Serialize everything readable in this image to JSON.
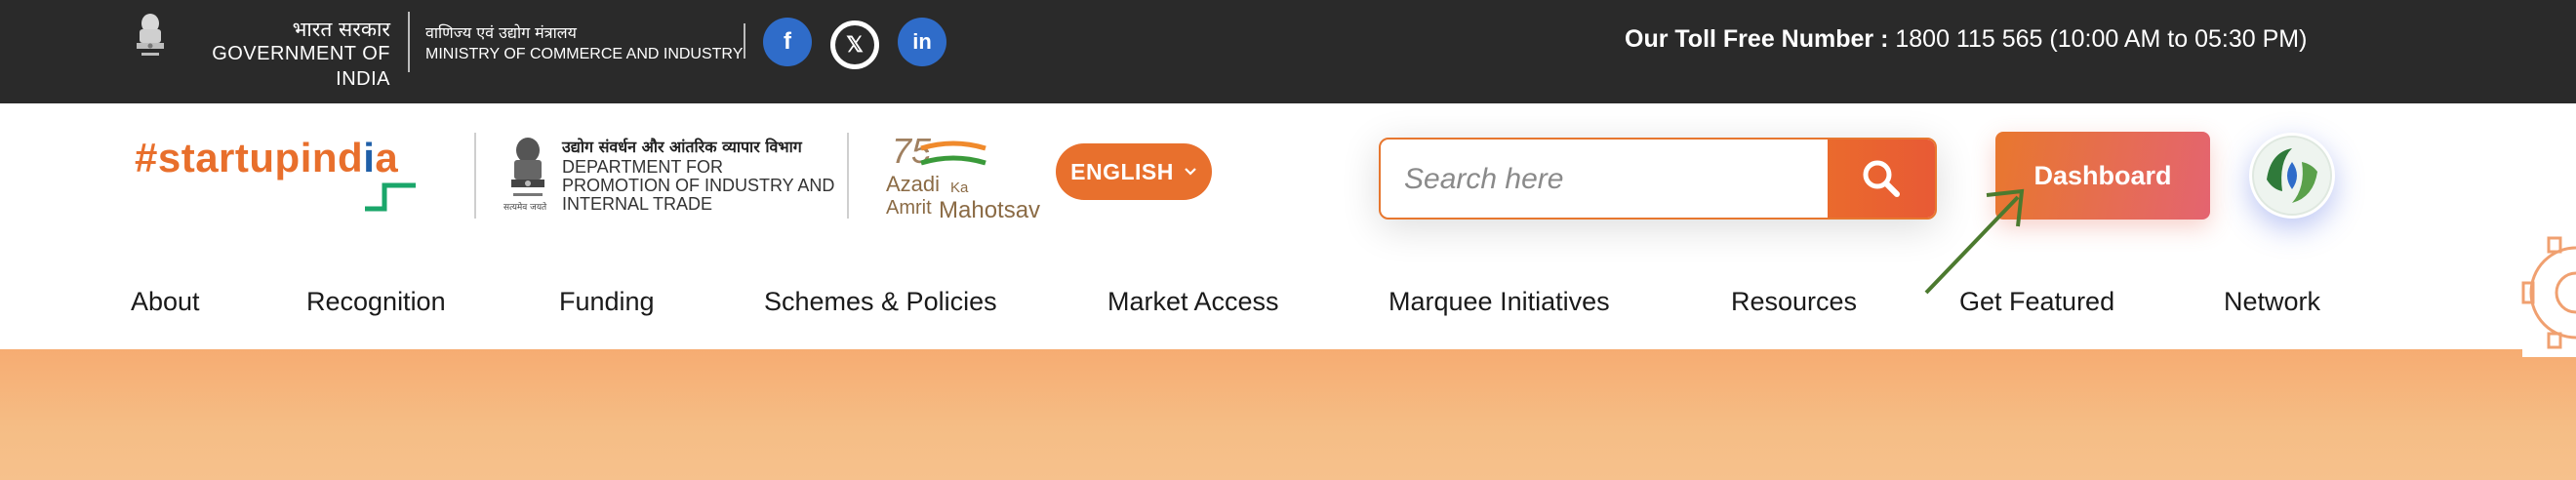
{
  "topbar": {
    "gov_hindi": "भारत सरकार",
    "gov_english": "GOVERNMENT OF INDIA",
    "ministry_hindi": "वाणिज्य एवं उद्योग मंत्रालय",
    "ministry_english": "MINISTRY OF COMMERCE AND INDUSTRY",
    "emblem_caption": "सत्यमेव जयते",
    "social": [
      {
        "name": "facebook",
        "glyph": "f",
        "color": "#2f6cc9"
      },
      {
        "name": "x",
        "glyph": "𝕏",
        "color": "#2a2a2a"
      },
      {
        "name": "linkedin",
        "glyph": "in",
        "color": "#2f6cc9"
      }
    ],
    "toll_label": "Our Toll Free Number :",
    "toll_number": "1800 115 565",
    "toll_hours": "(10:00 AM to 05:30 PM)"
  },
  "header": {
    "logo_hash": "#startupind",
    "logo_i": "i",
    "logo_a": "a",
    "dept_hindi": "उद्योग संवर्धन और आंतरिक व्यापार विभाग",
    "dept_lines": [
      "DEPARTMENT FOR",
      "PROMOTION OF INDUSTRY AND",
      "INTERNAL TRADE"
    ],
    "dept_emblem_caption": "सत्यमेव जयते",
    "azadi_75": "75",
    "azadi_line1": "Azadi",
    "azadi_ka": "Ka",
    "azadi_line2": "Amrit",
    "azadi_line3": "Mahotsav",
    "language": "ENGLISH",
    "search_placeholder": "Search here",
    "dashboard_label": "Dashboard"
  },
  "nav": {
    "items": [
      "About",
      "Recognition",
      "Funding",
      "Schemes & Policies",
      "Market Access",
      "Marquee Initiatives",
      "Resources",
      "Get Featured",
      "Network"
    ]
  },
  "colors": {
    "brand_orange": "#e8702d",
    "topbar_bg": "#2a2a2a",
    "arrow_green": "#4c7a2f",
    "hero_peach": "#f5b57a"
  },
  "icons": {
    "search": "magnifier-icon",
    "chevron": "chevron-down-icon",
    "emblem": "national-emblem-icon"
  }
}
